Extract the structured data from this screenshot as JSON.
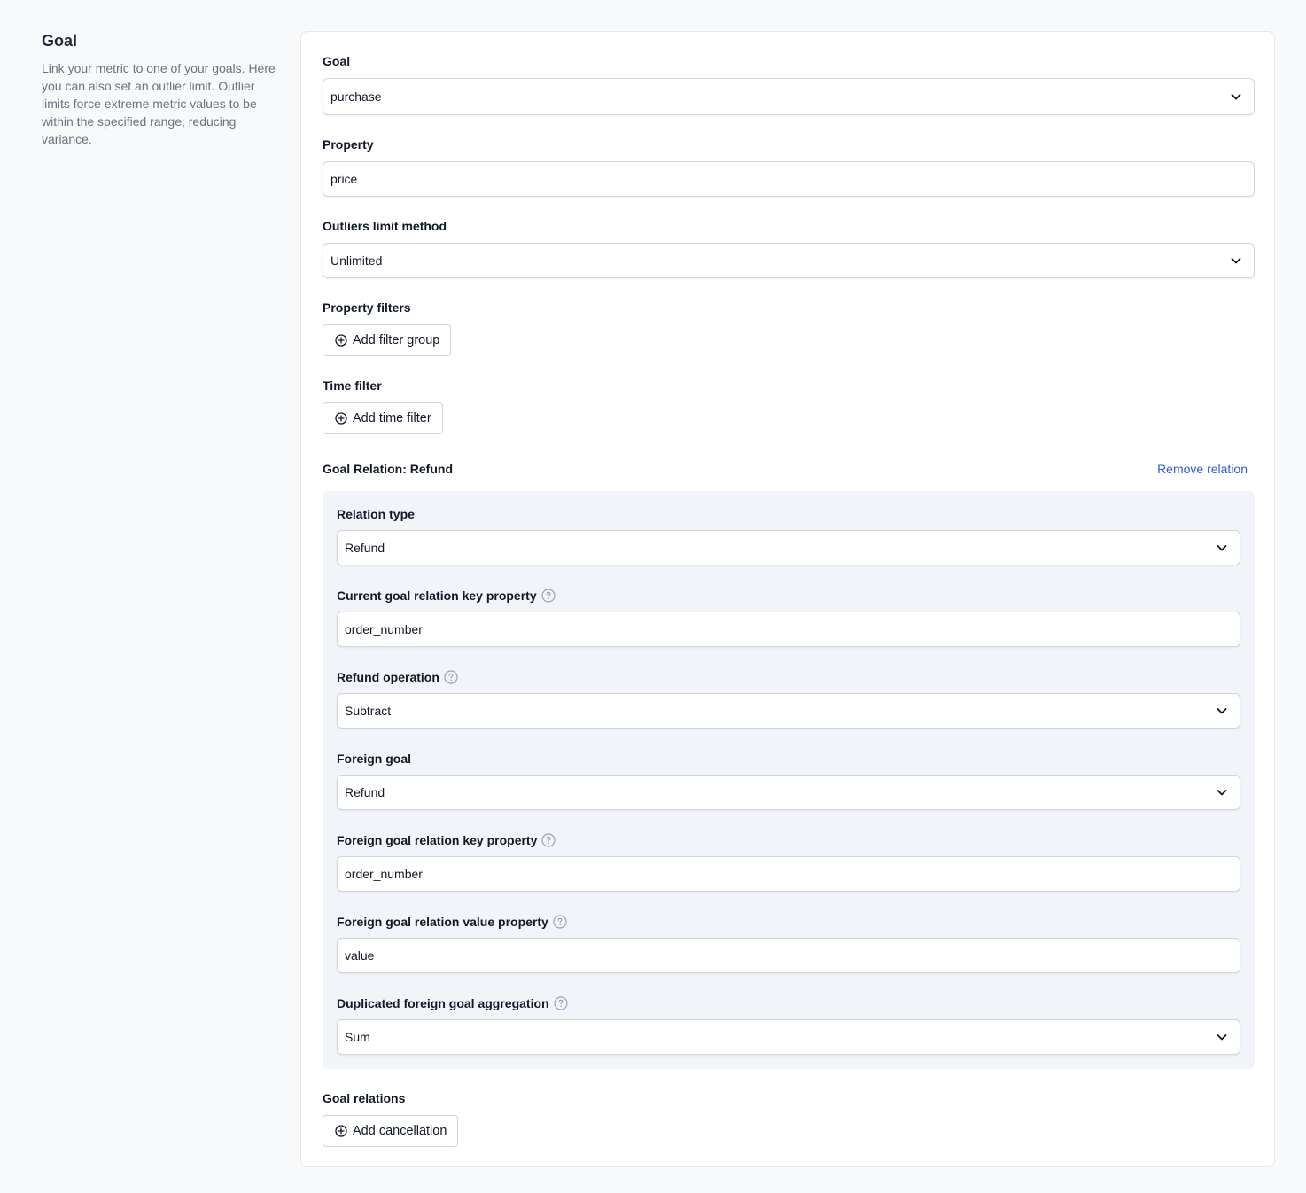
{
  "sidebar": {
    "title": "Goal",
    "description": "Link your metric to one of your goals. Here you can also set an outlier limit. Outlier limits force extreme metric values to be within the specified range, reducing variance."
  },
  "form": {
    "goal": {
      "label": "Goal",
      "value": "purchase"
    },
    "property": {
      "label": "Property",
      "value": "price"
    },
    "outliers": {
      "label": "Outliers limit method",
      "value": "Unlimited"
    },
    "property_filters": {
      "label": "Property filters",
      "button": "Add filter group"
    },
    "time_filter": {
      "label": "Time filter",
      "button": "Add time filter"
    },
    "relation": {
      "title": "Goal Relation: Refund",
      "remove": "Remove relation",
      "relation_type": {
        "label": "Relation type",
        "value": "Refund"
      },
      "current_key": {
        "label": "Current goal relation key property",
        "value": "order_number"
      },
      "refund_operation": {
        "label": "Refund operation",
        "value": "Subtract"
      },
      "foreign_goal": {
        "label": "Foreign goal",
        "value": "Refund"
      },
      "foreign_key": {
        "label": "Foreign goal relation key property",
        "value": "order_number"
      },
      "foreign_value": {
        "label": "Foreign goal relation value property",
        "value": "value"
      },
      "aggregation": {
        "label": "Duplicated foreign goal aggregation",
        "value": "Sum"
      }
    },
    "goal_relations": {
      "label": "Goal relations",
      "button": "Add cancellation"
    }
  },
  "icons": {
    "chevron": "chevron-down-icon",
    "help": "question-circle-icon",
    "add": "plus-circle-icon"
  },
  "colors": {
    "link": "#2f5bd3",
    "relation_bg": "#f1f4f8"
  }
}
